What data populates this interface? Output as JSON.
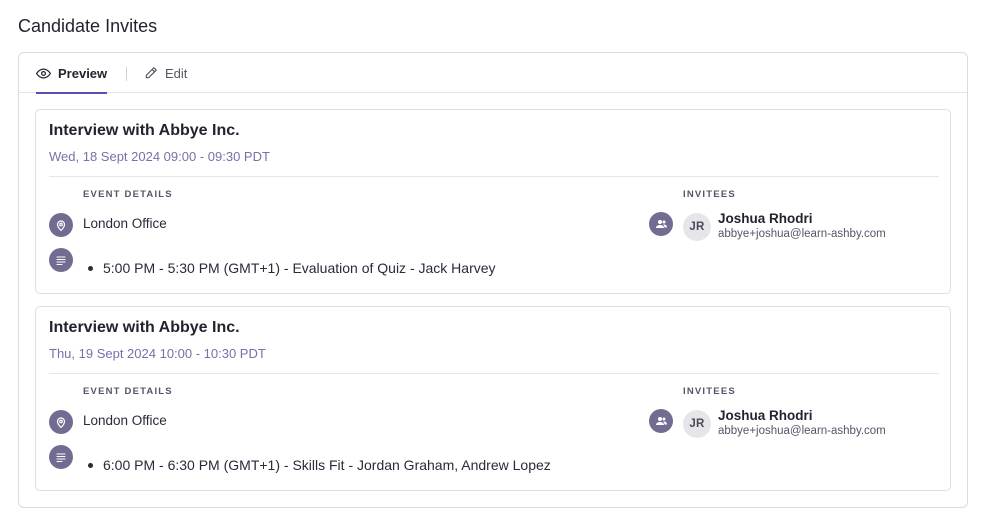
{
  "page": {
    "title": "Candidate Invites"
  },
  "tabs": [
    {
      "label": "Preview",
      "icon": "eye-icon",
      "active": true
    },
    {
      "label": "Edit",
      "icon": "pencil-icon",
      "active": false
    }
  ],
  "colors": {
    "accent": "#5b4fb3",
    "icon_bg": "#726c92",
    "time_text": "#7b6fa8"
  },
  "section_labels": {
    "details": "EVENT DETAILS",
    "invitees": "INVITEES"
  },
  "events": [
    {
      "title": "Interview with Abbye Inc.",
      "time": "Wed, 18 Sept 2024 09:00 - 09:30 PDT",
      "location": "London Office",
      "agenda": [
        "5:00 PM - 5:30 PM (GMT+1) - Evaluation of Quiz - Jack Harvey"
      ],
      "invitee": {
        "initials": "JR",
        "name": "Joshua Rhodri",
        "email": "abbye+joshua@learn-ashby.com"
      }
    },
    {
      "title": "Interview with Abbye Inc.",
      "time": "Thu, 19 Sept 2024 10:00 - 10:30 PDT",
      "location": "London Office",
      "agenda": [
        "6:00 PM - 6:30 PM (GMT+1) - Skills Fit - Jordan Graham, Andrew Lopez"
      ],
      "invitee": {
        "initials": "JR",
        "name": "Joshua Rhodri",
        "email": "abbye+joshua@learn-ashby.com"
      }
    }
  ]
}
